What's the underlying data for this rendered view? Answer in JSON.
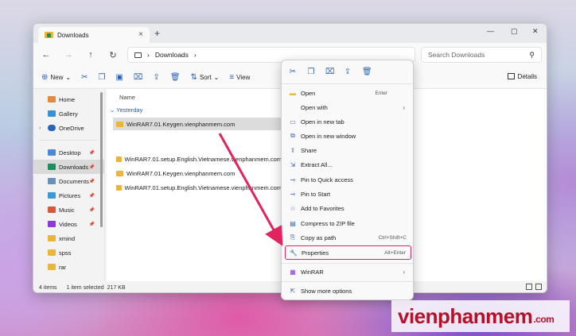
{
  "window": {
    "tab_title": "Downloads",
    "tab_close": "×",
    "new_tab": "+",
    "controls": [
      "—",
      "▢",
      "✕"
    ]
  },
  "nav": {
    "back": "←",
    "forward": "→",
    "up": "↑",
    "refresh": "↻",
    "address_chevron": "›",
    "address": "Downloads",
    "address_after": "›",
    "search_placeholder": "Search Downloads"
  },
  "toolbar": {
    "new_label": "New",
    "sort_label": "Sort",
    "view_label": "View",
    "details_label": "Details"
  },
  "sidebar": {
    "items": [
      {
        "label": "Home",
        "color": "#e6893b"
      },
      {
        "label": "Gallery",
        "color": "#3a8fd9"
      },
      {
        "label": "OneDrive",
        "color": "#2b63b8"
      },
      {
        "label": "Desktop",
        "color": "#4a8ad6"
      },
      {
        "label": "Downloads",
        "color": "#1e8f5a"
      },
      {
        "label": "Documents",
        "color": "#6c8fb8"
      },
      {
        "label": "Pictures",
        "color": "#3a9ad9"
      },
      {
        "label": "Music",
        "color": "#d9563a"
      },
      {
        "label": "Videos",
        "color": "#8a3ad9"
      },
      {
        "label": "xmind",
        "color": "#e8b63c"
      },
      {
        "label": "spss",
        "color": "#e8b63c"
      },
      {
        "label": "rar",
        "color": "#e8b63c"
      }
    ]
  },
  "content": {
    "column_name": "Name",
    "group": "Yesterday",
    "files": [
      "WinRAR7.01.Keygen.vienphanmem.com",
      "WinRAR7.01.setup.English.Vietnamese.vienphanmem.com",
      "WinRAR7.01.Keygen.vienphanmem.com",
      "WinRAR7.01.setup.English.Vietnamese.vienphanmem.com"
    ]
  },
  "status": {
    "items": "4 items",
    "selected": "1 item selected",
    "size": "217 KB"
  },
  "context_menu": {
    "items": [
      {
        "label": "Open",
        "shortcut": "Enter"
      },
      {
        "label": "Open with",
        "shortcut": "›"
      },
      {
        "label": "Open in new tab",
        "shortcut": ""
      },
      {
        "label": "Open in new window",
        "shortcut": ""
      },
      {
        "label": "Share",
        "shortcut": ""
      },
      {
        "label": "Extract All...",
        "shortcut": ""
      },
      {
        "label": "Pin to Quick access",
        "shortcut": ""
      },
      {
        "label": "Pin to Start",
        "shortcut": ""
      },
      {
        "label": "Add to Favorites",
        "shortcut": ""
      },
      {
        "label": "Compress to ZIP file",
        "shortcut": ""
      },
      {
        "label": "Copy as path",
        "shortcut": "Ctrl+Shift+C"
      },
      {
        "label": "Properties",
        "shortcut": "Alt+Enter"
      },
      {
        "label": "WinRAR",
        "shortcut": "›"
      },
      {
        "label": "Show more options",
        "shortcut": ""
      }
    ]
  },
  "watermark": {
    "main": "vienphanmem",
    "suffix": ".com"
  },
  "colors": {
    "accent": "#2b63b8",
    "highlight_border": "#e0245e",
    "arrow": "#e0245e",
    "brand": "#b5122a"
  }
}
